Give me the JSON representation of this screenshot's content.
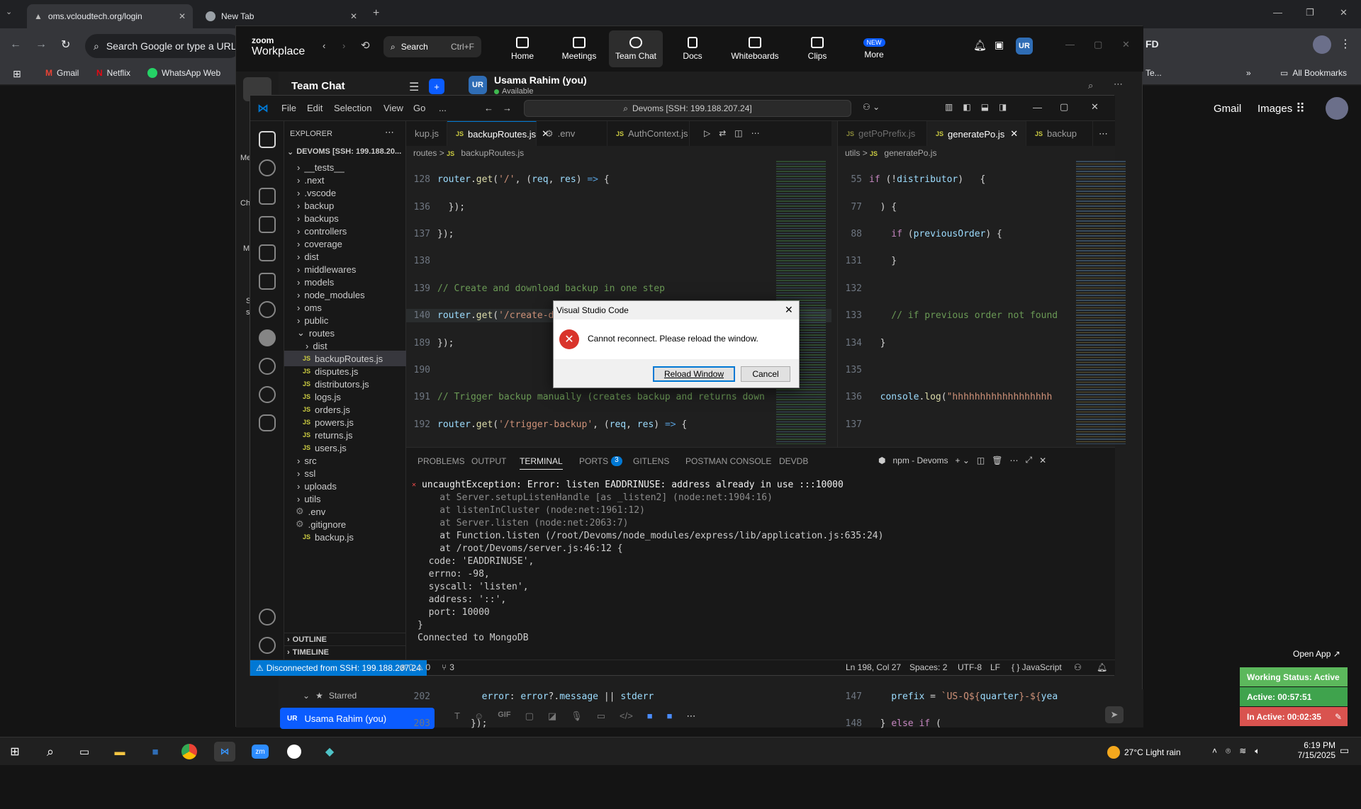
{
  "chrome": {
    "tabs": [
      {
        "title": "oms.vcloudtech.org/login"
      },
      {
        "title": "New Tab"
      }
    ],
    "omnibox_placeholder": "Search Google or type a URL",
    "bookmarks": [
      "Gmail",
      "Netflix",
      "WhatsApp Web",
      "Te...",
      "All Bookmarks"
    ],
    "google_links": [
      "Gmail",
      "Images"
    ],
    "profile_badge": "FD"
  },
  "zoom": {
    "brand_line1": "zoom",
    "brand_line2": "Workplace",
    "search_label": "Search",
    "search_shortcut": "Ctrl+F",
    "nav": [
      "Home",
      "Meetings",
      "Team Chat",
      "Docs",
      "Whiteboards",
      "Clips",
      "More"
    ],
    "new_badge": "NEW",
    "avatar": "UR",
    "sidebar_title": "Team Chat",
    "user_name": "Usama Rahim (you)",
    "user_status": "Available",
    "starred_label": "Starred",
    "starred_user": "Usama Rahim (you)",
    "toolbar_gif": "GIF",
    "open_app": "Open App ↗",
    "left_snips": [
      "Me",
      "Ch",
      "M",
      "S",
      "s",
      "I"
    ]
  },
  "vscode": {
    "menu": [
      "File",
      "Edit",
      "Selection",
      "View",
      "Go",
      "..."
    ],
    "command_center": "Devoms [SSH: 199.188.207.24]",
    "explorer_title": "EXPLORER",
    "root": "DEVOMS [SSH: 199.188.20...",
    "tree": [
      {
        "label": "__tests__",
        "type": "folder"
      },
      {
        "label": ".next",
        "type": "folder"
      },
      {
        "label": ".vscode",
        "type": "folder"
      },
      {
        "label": "backup",
        "type": "folder"
      },
      {
        "label": "backups",
        "type": "folder"
      },
      {
        "label": "controllers",
        "type": "folder"
      },
      {
        "label": "coverage",
        "type": "folder"
      },
      {
        "label": "dist",
        "type": "folder"
      },
      {
        "label": "middlewares",
        "type": "folder"
      },
      {
        "label": "models",
        "type": "folder"
      },
      {
        "label": "node_modules",
        "type": "folder"
      },
      {
        "label": "oms",
        "type": "folder"
      },
      {
        "label": "public",
        "type": "folder"
      },
      {
        "label": "routes",
        "type": "open"
      },
      {
        "label": "dist",
        "type": "subfolder"
      },
      {
        "label": "backupRoutes.js",
        "type": "jsfile",
        "selected": true
      },
      {
        "label": "disputes.js",
        "type": "jsfile"
      },
      {
        "label": "distributors.js",
        "type": "jsfile"
      },
      {
        "label": "logs.js",
        "type": "jsfile"
      },
      {
        "label": "orders.js",
        "type": "jsfile"
      },
      {
        "label": "powers.js",
        "type": "jsfile"
      },
      {
        "label": "returns.js",
        "type": "jsfile"
      },
      {
        "label": "users.js",
        "type": "jsfile"
      },
      {
        "label": "src",
        "type": "folder"
      },
      {
        "label": "ssl",
        "type": "folder"
      },
      {
        "label": "uploads",
        "type": "folder"
      },
      {
        "label": "utils",
        "type": "folder"
      },
      {
        "label": ".env",
        "type": "env"
      },
      {
        "label": ".gitignore",
        "type": "env"
      },
      {
        "label": "backup.js",
        "type": "jsfile"
      }
    ],
    "outline_label": "OUTLINE",
    "timeline_label": "TIMELINE",
    "editor1_tabs": [
      "kup.js",
      "backupRoutes.js",
      ".env",
      "AuthContext.js"
    ],
    "editor1_crumb": [
      "routes",
      ">",
      "JS",
      "backupRoutes.js"
    ],
    "editor2_tabs": [
      "getPoPrefix.js",
      "generatePo.js",
      "backup"
    ],
    "editor2_crumb": [
      "utils",
      ">",
      "JS",
      "generatePo.js"
    ],
    "panel_tabs": [
      "PROBLEMS",
      "OUTPUT",
      "TERMINAL",
      "PORTS",
      "GITLENS",
      "POSTMAN CONSOLE",
      "DEVDB"
    ],
    "ports_count": "3",
    "terminal_label": "npm - Devoms",
    "terminal_lines": [
      "uncaughtException: Error: listen EADDRINUSE: address already in use :::10000",
      "    at Server.setupListenHandle [as _listen2] (node:net:1904:16)",
      "    at listenInCluster (node:net:1961:12)",
      "    at Server.listen (node:net:2063:7)",
      "    at Function.listen (/root/Devoms/node_modules/express/lib/application.js:635:24)",
      "    at /root/Devoms/server.js:46:12 {",
      "  code: 'EADDRINUSE',",
      "  errno: -98,",
      "  syscall: 'listen',",
      "  address: '::',",
      "  port: 10000",
      "}",
      "Connected to MongoDB"
    ],
    "status_remote": "Disconnected from SSH: 199.188.207.24",
    "status_problems": "⊗ 0 ⚠ 0",
    "status_ports": "3",
    "status_right": [
      "Ln 198, Col 27",
      "Spaces: 2",
      "UTF-8",
      "LF",
      "{ } JavaScript"
    ]
  },
  "dialog": {
    "title": "Visual Studio Code",
    "message": "Cannot reconnect. Please reload the window.",
    "primary_button": "Reload Window",
    "secondary_button": "Cancel"
  },
  "widgets": {
    "working_status": "Working Status: Active",
    "active": "Active: 00:57:51",
    "inactive": "In Active: 00:02:35",
    "colors": {
      "working": "#5cb85c",
      "active": "#3fa34d",
      "inactive": "#d9534f"
    }
  },
  "taskbar": {
    "weather": "27°C  Light rain",
    "time": "6:19 PM",
    "date": "7/15/2025"
  }
}
